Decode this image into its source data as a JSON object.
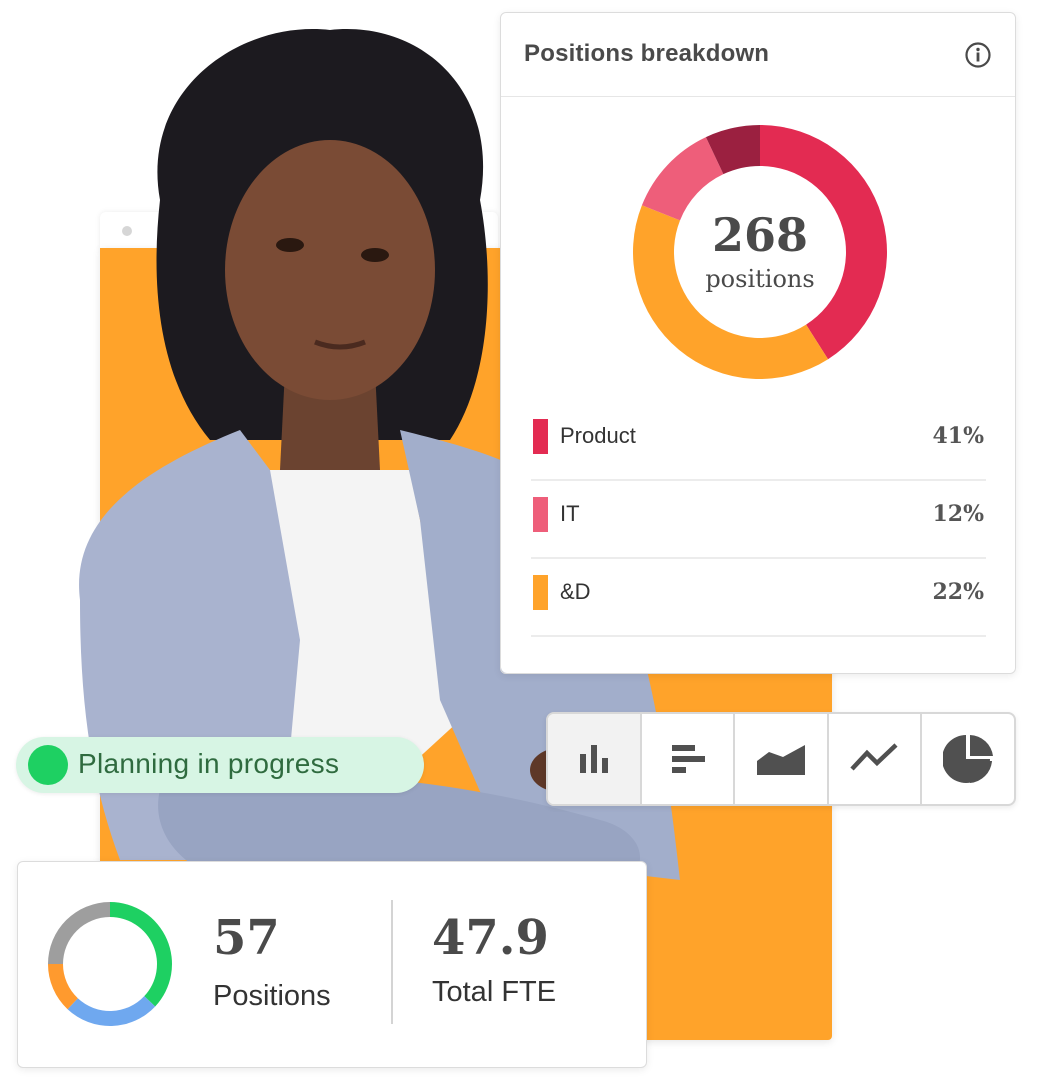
{
  "status": {
    "label": "Planning in progress",
    "dot_color": "#1ed062"
  },
  "breakdown_card": {
    "title": "Positions breakdown",
    "info_icon": "info-circle-icon",
    "total_value": "268",
    "total_label": "positions",
    "legend": [
      {
        "label": "Product",
        "value": "41%",
        "color": "#e32b52"
      },
      {
        "label": "IT",
        "value": "12%",
        "color": "#ee5e7a"
      },
      {
        "label": "&D",
        "value": "22%",
        "color": "#ffa32a"
      }
    ]
  },
  "chart_type_toolbar": {
    "items": [
      {
        "icon": "bar-chart-icon",
        "active": true
      },
      {
        "icon": "horizontal-bar-chart-icon",
        "active": false
      },
      {
        "icon": "area-chart-icon",
        "active": false
      },
      {
        "icon": "line-chart-icon",
        "active": false
      },
      {
        "icon": "pie-chart-icon",
        "active": false
      }
    ]
  },
  "summary_card": {
    "positions_value": "57",
    "positions_label": "Positions",
    "fte_value": "47.9",
    "fte_label": "Total FTE"
  },
  "chart_data": [
    {
      "type": "pie",
      "title": "Positions breakdown",
      "center_value": "268",
      "center_label": "positions",
      "slices": [
        {
          "name": "Product",
          "value": 41,
          "color": "#e32b52"
        },
        {
          "name": "&D",
          "value": 40,
          "color": "#ffa32a"
        },
        {
          "name": "IT",
          "value": 12,
          "color": "#ee5e7a"
        },
        {
          "name": "",
          "value": 7,
          "color": "#9b2040"
        }
      ]
    },
    {
      "type": "pie",
      "title": "",
      "slices": [
        {
          "name": "",
          "value": 37,
          "color": "#1ed062"
        },
        {
          "name": "",
          "value": 25,
          "color": "#6fa8ef"
        },
        {
          "name": "",
          "value": 13,
          "color": "#ff9a2e"
        },
        {
          "name": "",
          "value": 25,
          "color": "#9e9e9e"
        }
      ]
    }
  ]
}
